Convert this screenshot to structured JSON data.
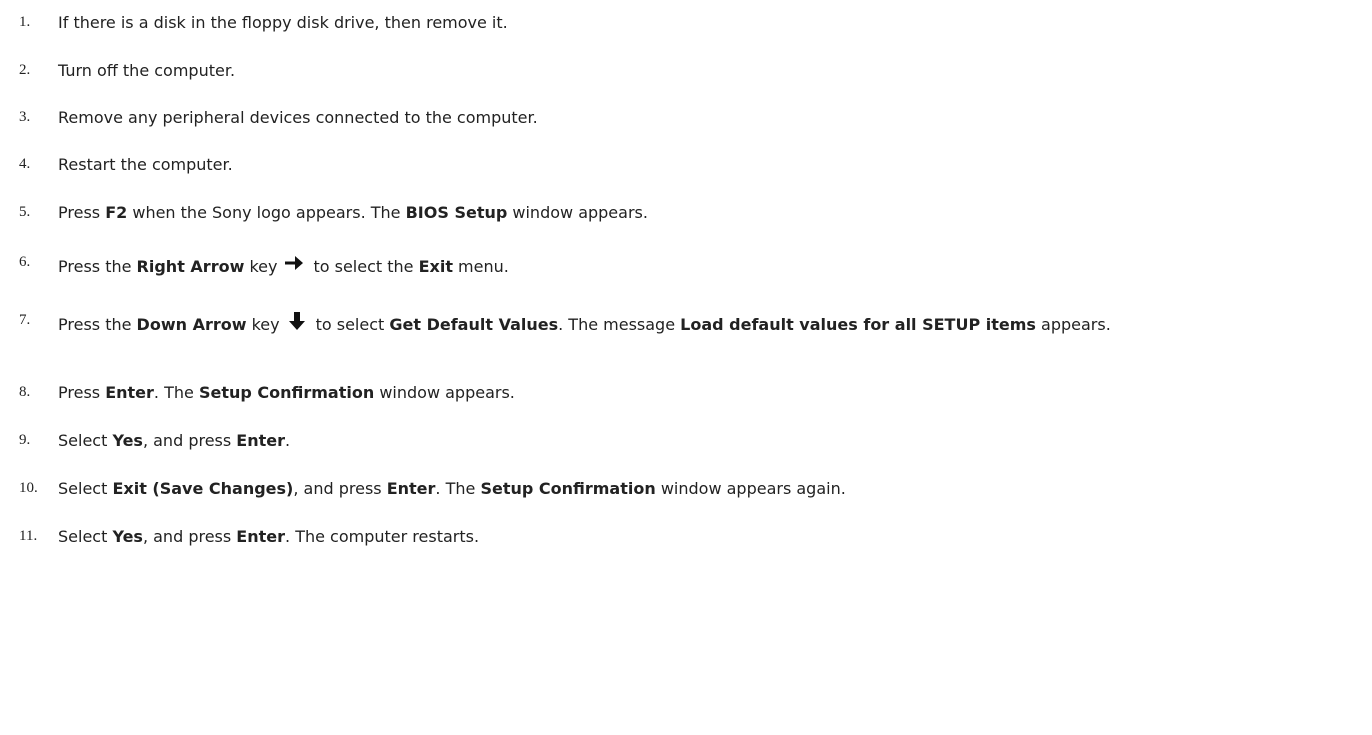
{
  "steps": [
    {
      "num": "1.",
      "parts": [
        "If there is a disk in the floppy disk drive, then remove it."
      ]
    },
    {
      "num": "2.",
      "parts": [
        "Turn off the computer."
      ]
    },
    {
      "num": "3.",
      "parts": [
        "Remove any peripheral devices connected to the computer."
      ]
    },
    {
      "num": "4.",
      "parts": [
        "Restart the computer."
      ]
    },
    {
      "num": "5.",
      "parts": [
        "Press ",
        "F2",
        " when the Sony logo appears. The ",
        "BIOS Setup",
        " window appears."
      ]
    },
    {
      "num": "6.",
      "parts": [
        "Press the ",
        "Right Arrow",
        " key",
        "to select the ",
        "Exit",
        " menu."
      ],
      "icon": "right-arrow-icon"
    },
    {
      "num": "7.",
      "parts": [
        "Press the ",
        "Down Arrow",
        " key",
        "to select ",
        "Get Default Values",
        ". The message ",
        "Load default values for all SETUP items",
        " appears."
      ],
      "icon": "down-arrow-icon"
    },
    {
      "num": "8.",
      "parts": [
        "Press ",
        "Enter",
        ". The ",
        "Setup Confirmation",
        " window appears."
      ]
    },
    {
      "num": "9.",
      "parts": [
        "Select ",
        "Yes",
        ", and press ",
        "Enter",
        "."
      ]
    },
    {
      "num": "10.",
      "parts": [
        "Select ",
        "Exit (Save Changes)",
        ", and press ",
        "Enter",
        ". The ",
        "Setup Confirmation",
        " window appears again."
      ]
    },
    {
      "num": "11.",
      "parts": [
        "Select ",
        "Yes",
        ", and press ",
        "Enter",
        ". The computer restarts."
      ]
    }
  ]
}
